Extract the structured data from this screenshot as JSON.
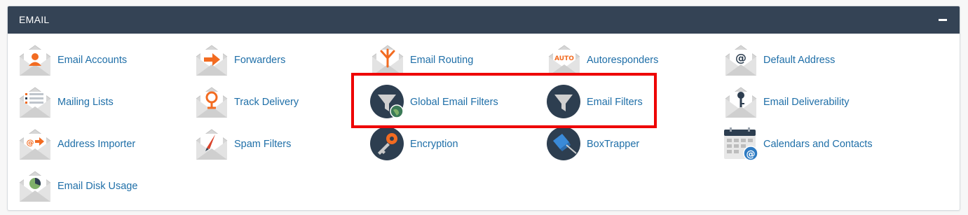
{
  "section": {
    "title": "EMAIL",
    "collapse_icon": "minus-icon"
  },
  "items": [
    {
      "label": "Email Accounts",
      "icon": "email-accounts-icon"
    },
    {
      "label": "Forwarders",
      "icon": "forwarders-icon"
    },
    {
      "label": "Email Routing",
      "icon": "email-routing-icon"
    },
    {
      "label": "Autoresponders",
      "icon": "autoresponders-icon",
      "icon_text": "AUTO"
    },
    {
      "label": "Default Address",
      "icon": "default-address-icon"
    },
    {
      "label": "Mailing Lists",
      "icon": "mailing-lists-icon"
    },
    {
      "label": "Track Delivery",
      "icon": "track-delivery-icon"
    },
    {
      "label": "Global Email Filters",
      "icon": "global-email-filters-icon"
    },
    {
      "label": "Email Filters",
      "icon": "email-filters-icon"
    },
    {
      "label": "Email Deliverability",
      "icon": "email-deliverability-icon"
    },
    {
      "label": "Address Importer",
      "icon": "address-importer-icon"
    },
    {
      "label": "Spam Filters",
      "icon": "spam-filters-icon"
    },
    {
      "label": "Encryption",
      "icon": "encryption-icon"
    },
    {
      "label": "BoxTrapper",
      "icon": "boxtrapper-icon"
    },
    {
      "label": "Calendars and Contacts",
      "icon": "calendars-contacts-icon"
    },
    {
      "label": "Email Disk Usage",
      "icon": "email-disk-usage-icon"
    }
  ],
  "colors": {
    "header_bg": "#344355",
    "link": "#1f6fa8",
    "accent_orange": "#f26b21",
    "dark_circle": "#2d3e50",
    "highlight_border": "#ee0000"
  }
}
